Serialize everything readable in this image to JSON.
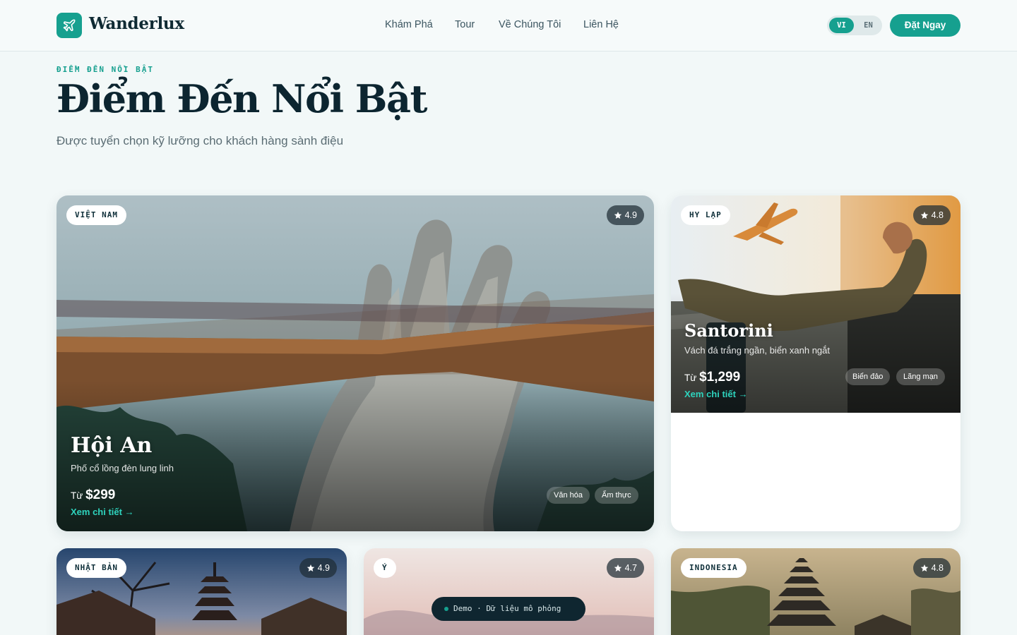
{
  "brand": {
    "name": "Wanderlux",
    "logo_icon": "plane-icon",
    "accent": "#16a08f"
  },
  "nav": {
    "items": [
      "Khám Phá",
      "Tour",
      "Về Chúng Tôi",
      "Liên Hệ"
    ]
  },
  "lang": {
    "vi": "VI",
    "en": "EN",
    "active": "VI"
  },
  "cta": {
    "label": "Đặt Ngay"
  },
  "section": {
    "eyebrow": "ĐIỂM ĐẾN NỔI BẬT",
    "title": "Điểm Đến Nổi Bật",
    "subtitle": "Được tuyển chọn kỹ lưỡng cho khách hàng sành điệu"
  },
  "cards": [
    {
      "country": "VIỆT NAM",
      "rating": "4.9",
      "title": "Hội An",
      "desc": "Phố cổ lồng đèn lung linh",
      "price_prefix": "Từ",
      "price": "$299",
      "link": "Xem chi tiết",
      "tags": [
        "Văn hóa",
        "Ẩm thực"
      ]
    },
    {
      "country": "HY LẠP",
      "rating": "4.8",
      "title": "Santorini",
      "desc": "Vách đá trắng ngần, biển xanh ngắt",
      "price_prefix": "Từ",
      "price": "$1,299",
      "link": "Xem chi tiết",
      "tags": [
        "Biển đảo",
        "Lãng mạn"
      ]
    },
    {
      "country": "NHẬT BẢN",
      "rating": "4.9"
    },
    {
      "country": "Ý",
      "rating": "4.7"
    },
    {
      "country": "INDONESIA",
      "rating": "4.8"
    }
  ],
  "demo": {
    "label": "Demo · Dữ liệu mô phỏng"
  }
}
